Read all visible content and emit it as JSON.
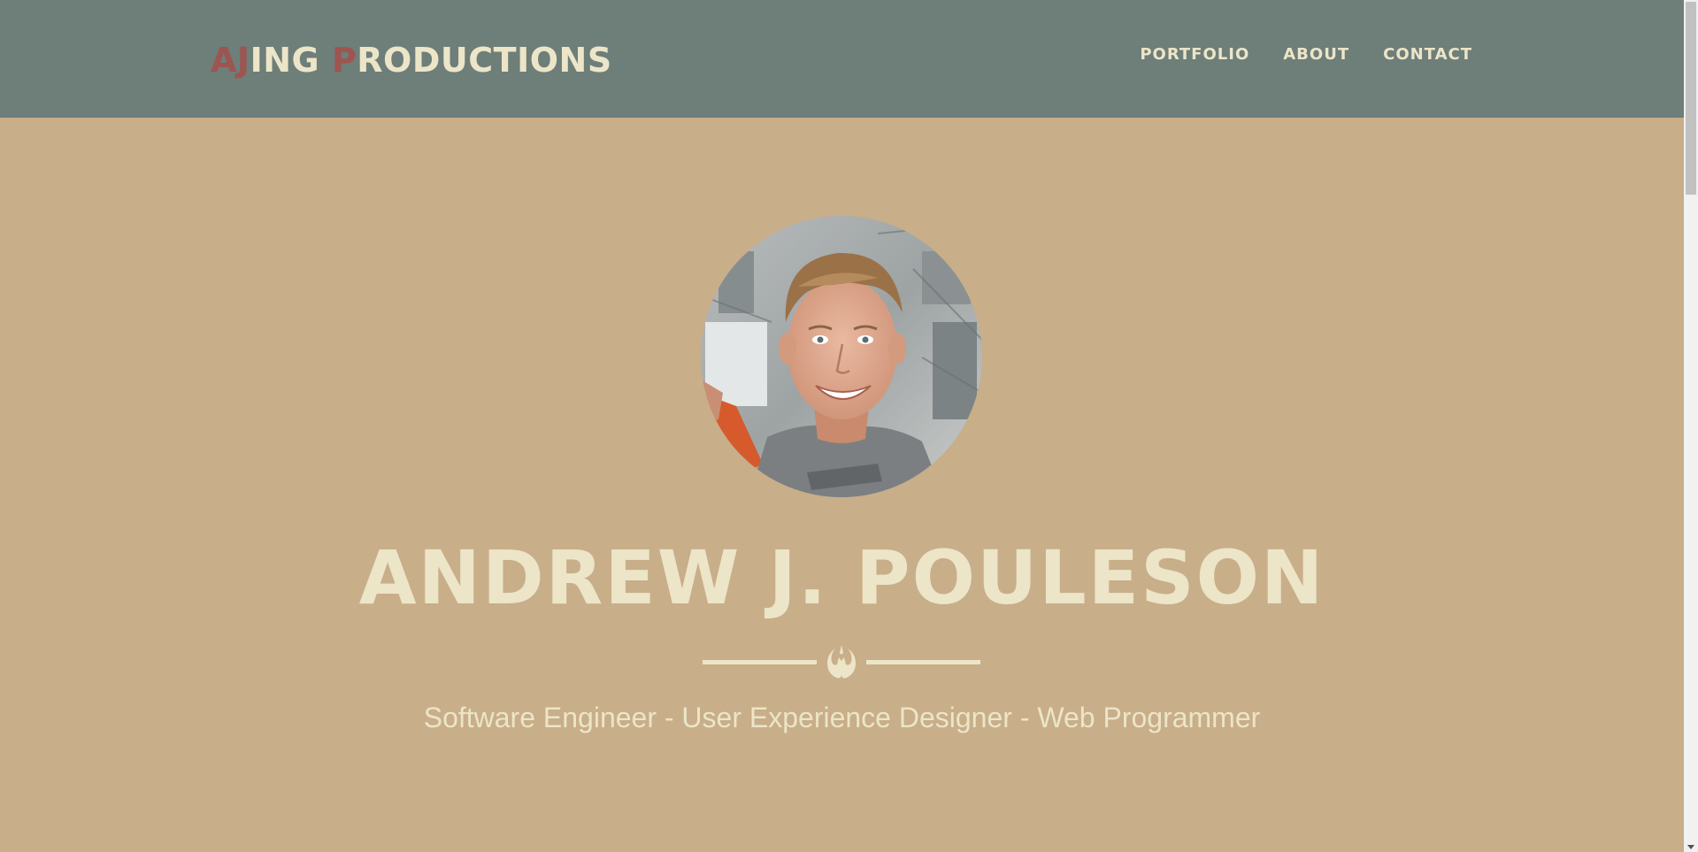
{
  "navbar": {
    "brand": {
      "parts": [
        {
          "text": "AJ",
          "accent": true
        },
        {
          "text": "ING ",
          "accent": false
        },
        {
          "text": "P",
          "accent": true
        },
        {
          "text": "RODUCTIONS",
          "accent": false
        }
      ]
    },
    "links": [
      {
        "label": "PORTFOLIO"
      },
      {
        "label": "ABOUT"
      },
      {
        "label": "CONTACT"
      }
    ]
  },
  "hero": {
    "avatar_alt": "Profile photo",
    "name": "ANDREW J. POULESON",
    "divider_icon": "rebel-alliance-icon",
    "subtitle": "Software Engineer - User Experience Designer - Web Programmer"
  },
  "colors": {
    "navbar_bg": "#6e7e79",
    "hero_bg": "#c8ae89",
    "text_light": "#ece5c8",
    "brand_accent": "#9e5450"
  }
}
